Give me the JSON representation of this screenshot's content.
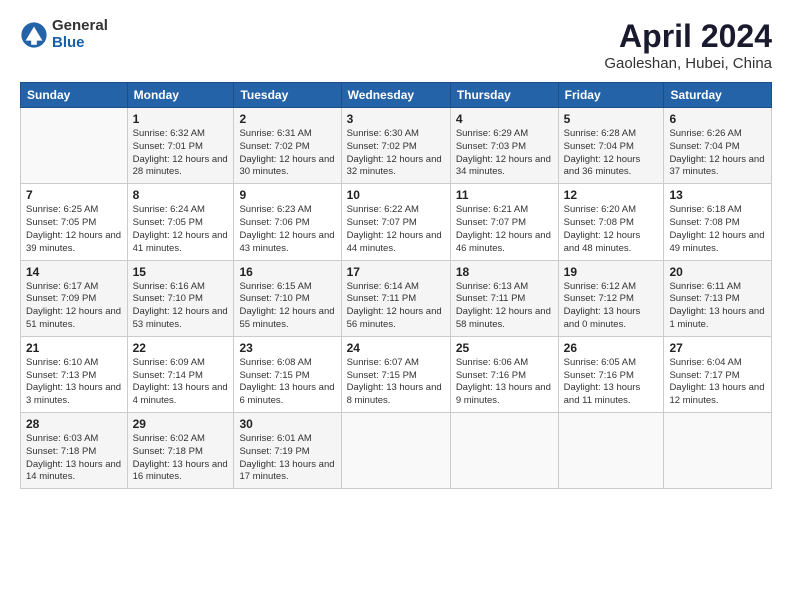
{
  "header": {
    "logo_general": "General",
    "logo_blue": "Blue",
    "month_title": "April 2024",
    "location": "Gaoleshan, Hubei, China"
  },
  "days_of_week": [
    "Sunday",
    "Monday",
    "Tuesday",
    "Wednesday",
    "Thursday",
    "Friday",
    "Saturday"
  ],
  "weeks": [
    [
      {
        "day": "",
        "sunrise": "",
        "sunset": "",
        "daylight": ""
      },
      {
        "day": "1",
        "sunrise": "Sunrise: 6:32 AM",
        "sunset": "Sunset: 7:01 PM",
        "daylight": "Daylight: 12 hours and 28 minutes."
      },
      {
        "day": "2",
        "sunrise": "Sunrise: 6:31 AM",
        "sunset": "Sunset: 7:02 PM",
        "daylight": "Daylight: 12 hours and 30 minutes."
      },
      {
        "day": "3",
        "sunrise": "Sunrise: 6:30 AM",
        "sunset": "Sunset: 7:02 PM",
        "daylight": "Daylight: 12 hours and 32 minutes."
      },
      {
        "day": "4",
        "sunrise": "Sunrise: 6:29 AM",
        "sunset": "Sunset: 7:03 PM",
        "daylight": "Daylight: 12 hours and 34 minutes."
      },
      {
        "day": "5",
        "sunrise": "Sunrise: 6:28 AM",
        "sunset": "Sunset: 7:04 PM",
        "daylight": "Daylight: 12 hours and 36 minutes."
      },
      {
        "day": "6",
        "sunrise": "Sunrise: 6:26 AM",
        "sunset": "Sunset: 7:04 PM",
        "daylight": "Daylight: 12 hours and 37 minutes."
      }
    ],
    [
      {
        "day": "7",
        "sunrise": "Sunrise: 6:25 AM",
        "sunset": "Sunset: 7:05 PM",
        "daylight": "Daylight: 12 hours and 39 minutes."
      },
      {
        "day": "8",
        "sunrise": "Sunrise: 6:24 AM",
        "sunset": "Sunset: 7:05 PM",
        "daylight": "Daylight: 12 hours and 41 minutes."
      },
      {
        "day": "9",
        "sunrise": "Sunrise: 6:23 AM",
        "sunset": "Sunset: 7:06 PM",
        "daylight": "Daylight: 12 hours and 43 minutes."
      },
      {
        "day": "10",
        "sunrise": "Sunrise: 6:22 AM",
        "sunset": "Sunset: 7:07 PM",
        "daylight": "Daylight: 12 hours and 44 minutes."
      },
      {
        "day": "11",
        "sunrise": "Sunrise: 6:21 AM",
        "sunset": "Sunset: 7:07 PM",
        "daylight": "Daylight: 12 hours and 46 minutes."
      },
      {
        "day": "12",
        "sunrise": "Sunrise: 6:20 AM",
        "sunset": "Sunset: 7:08 PM",
        "daylight": "Daylight: 12 hours and 48 minutes."
      },
      {
        "day": "13",
        "sunrise": "Sunrise: 6:18 AM",
        "sunset": "Sunset: 7:08 PM",
        "daylight": "Daylight: 12 hours and 49 minutes."
      }
    ],
    [
      {
        "day": "14",
        "sunrise": "Sunrise: 6:17 AM",
        "sunset": "Sunset: 7:09 PM",
        "daylight": "Daylight: 12 hours and 51 minutes."
      },
      {
        "day": "15",
        "sunrise": "Sunrise: 6:16 AM",
        "sunset": "Sunset: 7:10 PM",
        "daylight": "Daylight: 12 hours and 53 minutes."
      },
      {
        "day": "16",
        "sunrise": "Sunrise: 6:15 AM",
        "sunset": "Sunset: 7:10 PM",
        "daylight": "Daylight: 12 hours and 55 minutes."
      },
      {
        "day": "17",
        "sunrise": "Sunrise: 6:14 AM",
        "sunset": "Sunset: 7:11 PM",
        "daylight": "Daylight: 12 hours and 56 minutes."
      },
      {
        "day": "18",
        "sunrise": "Sunrise: 6:13 AM",
        "sunset": "Sunset: 7:11 PM",
        "daylight": "Daylight: 12 hours and 58 minutes."
      },
      {
        "day": "19",
        "sunrise": "Sunrise: 6:12 AM",
        "sunset": "Sunset: 7:12 PM",
        "daylight": "Daylight: 13 hours and 0 minutes."
      },
      {
        "day": "20",
        "sunrise": "Sunrise: 6:11 AM",
        "sunset": "Sunset: 7:13 PM",
        "daylight": "Daylight: 13 hours and 1 minute."
      }
    ],
    [
      {
        "day": "21",
        "sunrise": "Sunrise: 6:10 AM",
        "sunset": "Sunset: 7:13 PM",
        "daylight": "Daylight: 13 hours and 3 minutes."
      },
      {
        "day": "22",
        "sunrise": "Sunrise: 6:09 AM",
        "sunset": "Sunset: 7:14 PM",
        "daylight": "Daylight: 13 hours and 4 minutes."
      },
      {
        "day": "23",
        "sunrise": "Sunrise: 6:08 AM",
        "sunset": "Sunset: 7:15 PM",
        "daylight": "Daylight: 13 hours and 6 minutes."
      },
      {
        "day": "24",
        "sunrise": "Sunrise: 6:07 AM",
        "sunset": "Sunset: 7:15 PM",
        "daylight": "Daylight: 13 hours and 8 minutes."
      },
      {
        "day": "25",
        "sunrise": "Sunrise: 6:06 AM",
        "sunset": "Sunset: 7:16 PM",
        "daylight": "Daylight: 13 hours and 9 minutes."
      },
      {
        "day": "26",
        "sunrise": "Sunrise: 6:05 AM",
        "sunset": "Sunset: 7:16 PM",
        "daylight": "Daylight: 13 hours and 11 minutes."
      },
      {
        "day": "27",
        "sunrise": "Sunrise: 6:04 AM",
        "sunset": "Sunset: 7:17 PM",
        "daylight": "Daylight: 13 hours and 12 minutes."
      }
    ],
    [
      {
        "day": "28",
        "sunrise": "Sunrise: 6:03 AM",
        "sunset": "Sunset: 7:18 PM",
        "daylight": "Daylight: 13 hours and 14 minutes."
      },
      {
        "day": "29",
        "sunrise": "Sunrise: 6:02 AM",
        "sunset": "Sunset: 7:18 PM",
        "daylight": "Daylight: 13 hours and 16 minutes."
      },
      {
        "day": "30",
        "sunrise": "Sunrise: 6:01 AM",
        "sunset": "Sunset: 7:19 PM",
        "daylight": "Daylight: 13 hours and 17 minutes."
      },
      {
        "day": "",
        "sunrise": "",
        "sunset": "",
        "daylight": ""
      },
      {
        "day": "",
        "sunrise": "",
        "sunset": "",
        "daylight": ""
      },
      {
        "day": "",
        "sunrise": "",
        "sunset": "",
        "daylight": ""
      },
      {
        "day": "",
        "sunrise": "",
        "sunset": "",
        "daylight": ""
      }
    ]
  ]
}
